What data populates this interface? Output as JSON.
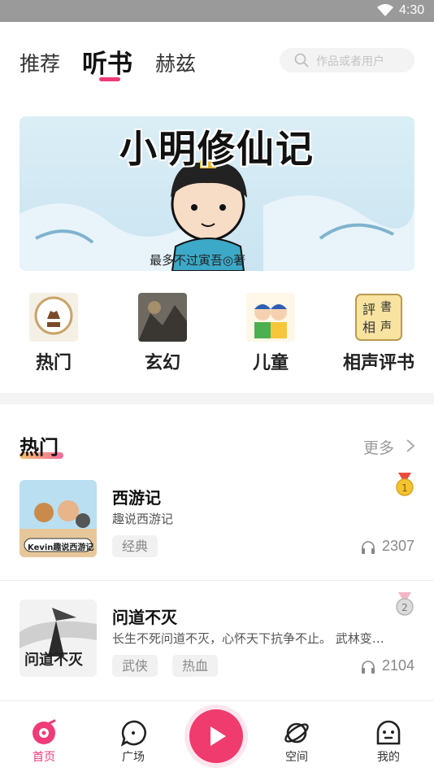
{
  "status": {
    "time": "4:30"
  },
  "nav": {
    "tabs": [
      {
        "label": "推荐",
        "active": false
      },
      {
        "label": "听书",
        "active": true
      },
      {
        "label": "赫兹",
        "active": false
      }
    ],
    "search_placeholder": "作品或者用户"
  },
  "banner": {
    "title": "小明修仙记",
    "author": "最多不过寅吾◎著"
  },
  "categories": [
    {
      "label": "热门",
      "icon": "popular-badge-icon"
    },
    {
      "label": "玄幻",
      "icon": "fantasy-cover-icon"
    },
    {
      "label": "儿童",
      "icon": "children-icon"
    },
    {
      "label": "相声评书",
      "icon": "crosstalk-icon"
    }
  ],
  "section": {
    "title": "热门",
    "more": "更多"
  },
  "items": [
    {
      "title": "西游记",
      "desc": "趣说西游记",
      "tags": [
        "经典"
      ],
      "plays": "2307",
      "rank": "1",
      "cover_text": "Kevin趣说西游记"
    },
    {
      "title": "问道不灭",
      "desc": "长生不死问道不灭，心怀天下抗争不止。 武林变…",
      "tags": [
        "武侠",
        "热血"
      ],
      "plays": "2104",
      "rank": "2",
      "cover_text": "问道不灭"
    }
  ],
  "tabbar": [
    {
      "label": "首页",
      "active": true
    },
    {
      "label": "广场",
      "active": false
    },
    {
      "label": "空间",
      "active": false
    },
    {
      "label": "我的",
      "active": false
    }
  ],
  "colors": {
    "accent": "#ef3b78",
    "play": "#ef3b6e"
  }
}
